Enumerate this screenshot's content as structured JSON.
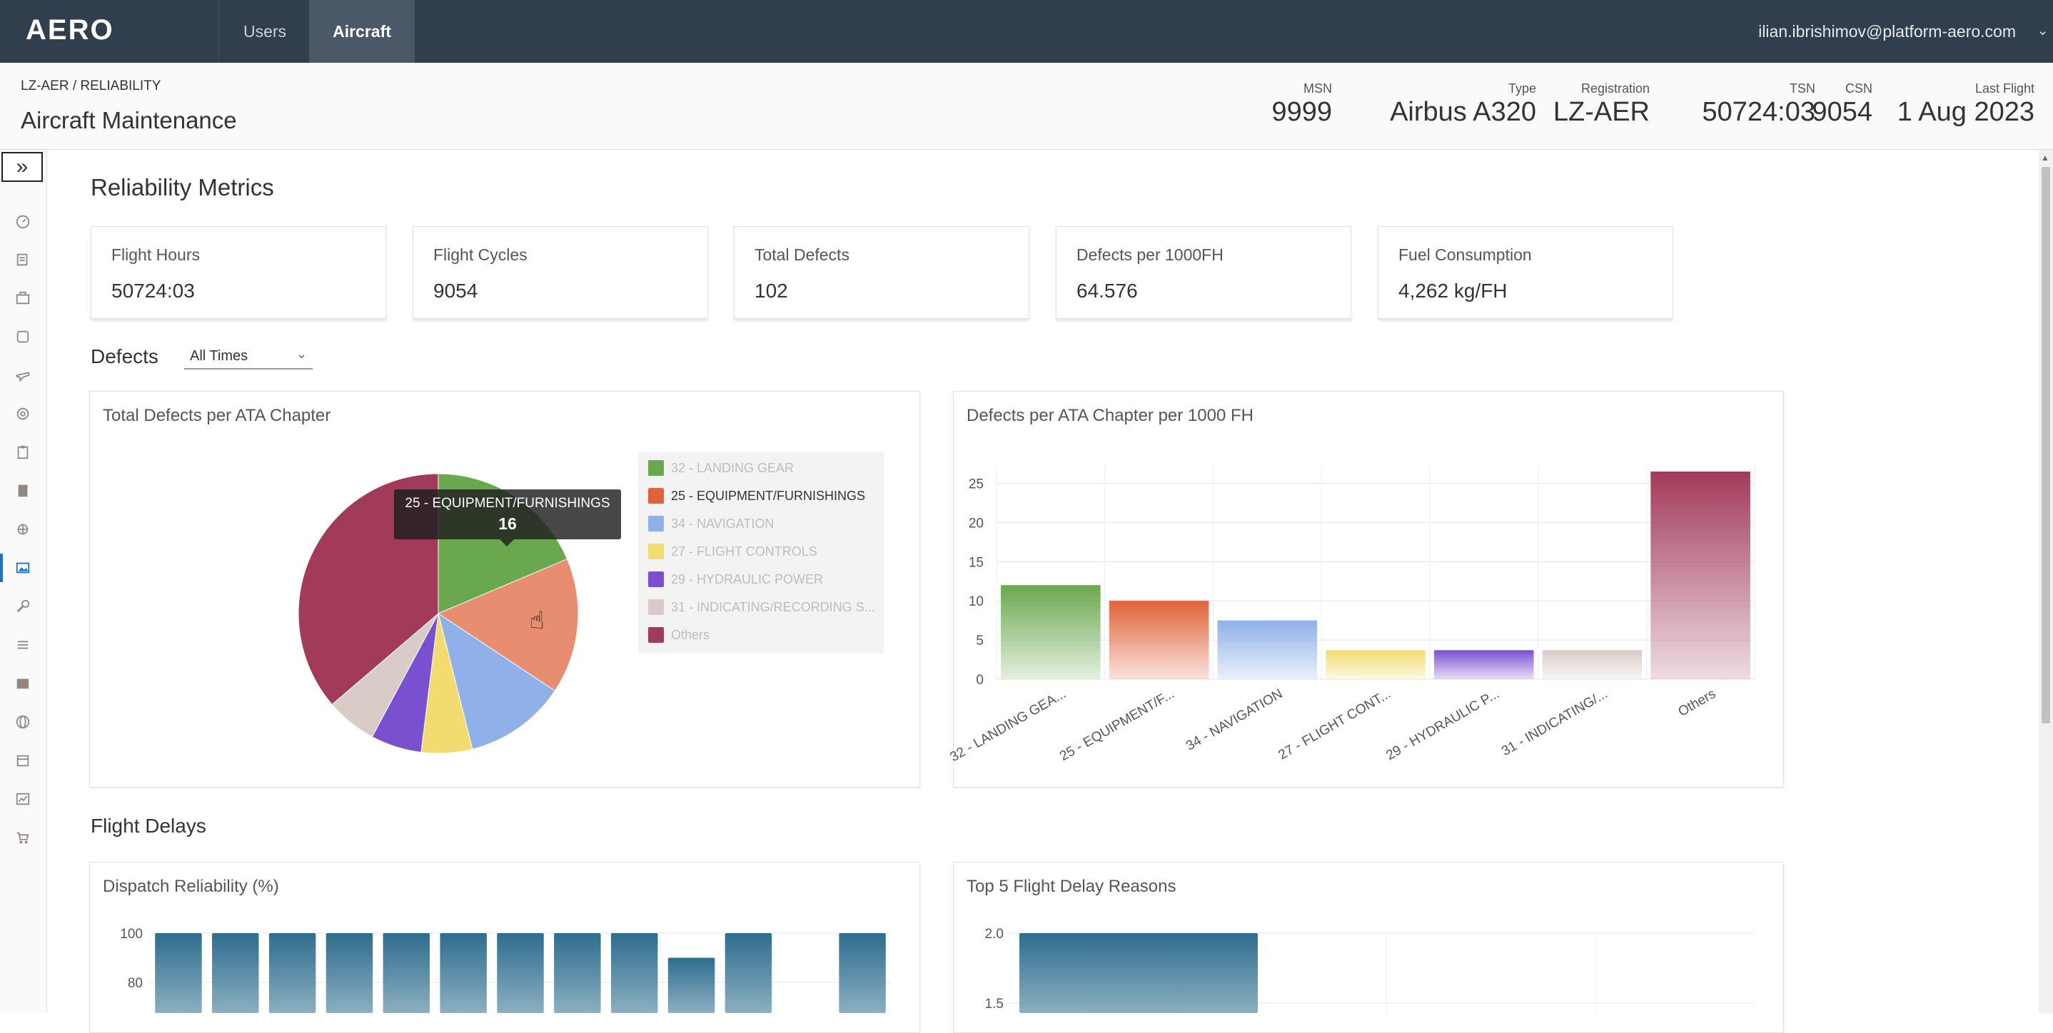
{
  "topbar": {
    "logo": "AERO",
    "nav": [
      {
        "label": "Users"
      },
      {
        "label": "Aircraft"
      }
    ],
    "user_email": "ilian.ibrishimov@platform-aero.com"
  },
  "subheader": {
    "breadcrumb": "LZ-AER / RELIABILITY",
    "title": "Aircraft Maintenance",
    "stats": [
      {
        "label": "MSN",
        "value": "9999"
      },
      {
        "label": "Type",
        "value": "Airbus A320"
      },
      {
        "label": "Registration",
        "value": "LZ-AER"
      },
      {
        "label": "TSN",
        "value": "50724:03"
      },
      {
        "label": "CSN",
        "value": "9054"
      },
      {
        "label": "Last Flight",
        "value": "1 Aug 2023"
      }
    ]
  },
  "sidebar": {
    "expand_glyph": "»",
    "icons": [
      "dashboard-icon",
      "notes-icon",
      "briefcase-icon",
      "box-icon",
      "plane-icon",
      "gear-icon",
      "clipboard-icon",
      "document-icon",
      "engine-icon",
      "image-icon",
      "wrench-icon",
      "list-icon",
      "checklist-icon",
      "globe-icon",
      "calendar-icon",
      "chart-icon",
      "cart-icon"
    ],
    "active": "image-icon"
  },
  "main": {
    "title": "Reliability Metrics",
    "kpis": [
      {
        "label": "Flight Hours",
        "value": "50724:03"
      },
      {
        "label": "Flight Cycles",
        "value": "9054"
      },
      {
        "label": "Total Defects",
        "value": "102"
      },
      {
        "label": "Defects per 1000FH",
        "value": "64.576"
      },
      {
        "label": "Fuel Consumption",
        "value": "4,262 kg/FH"
      }
    ],
    "defects_heading": "Defects",
    "period": {
      "selected": "All Times"
    },
    "flight_delays_heading": "Flight Delays"
  },
  "colors": {
    "green": "#6aa84f",
    "orange": "#e0623a",
    "blue": "#8fb0e8",
    "yellow": "#f2dc70",
    "purple": "#7a4fd0",
    "gray": "#d9cbc6",
    "maroon": "#a23a5a",
    "teal": "#2e6d8e"
  },
  "tooltip": {
    "label": "25 - EQUIPMENT/FURNISHINGS",
    "value": "16"
  },
  "chart_data": [
    {
      "type": "pie",
      "title": "Total Defects per ATA Chapter",
      "slices": [
        {
          "label": "32 - LANDING GEAR",
          "value": 19,
          "color": "#6aa84f"
        },
        {
          "label": "25 - EQUIPMENT/FURNISHINGS",
          "value": 16,
          "color": "#e0623a"
        },
        {
          "label": "34 - NAVIGATION",
          "value": 12,
          "color": "#8fb0e8"
        },
        {
          "label": "27 - FLIGHT CONTROLS",
          "value": 6,
          "color": "#f2dc70"
        },
        {
          "label": "29 - HYDRAULIC POWER",
          "value": 6,
          "color": "#7a4fd0"
        },
        {
          "label": "31 - INDICATING/RECORDING S...",
          "value": 6,
          "color": "#d9cbc6"
        },
        {
          "label": "Others",
          "value": 37,
          "color": "#a23a5a"
        }
      ]
    },
    {
      "type": "bar",
      "title": "Defects per ATA Chapter per 1000 FH",
      "categories": [
        "32 - LANDING GEA...",
        "25 - EQUIPMENT/F...",
        "34 - NAVIGATION",
        "27 - FLIGHT CONT...",
        "29 - HYDRAULIC P...",
        "31 - INDICATING/...",
        "Others"
      ],
      "values": [
        12,
        10,
        7.5,
        3.7,
        3.7,
        3.7,
        26.5
      ],
      "colors": [
        "#6aa84f",
        "#e0623a",
        "#8fb0e8",
        "#f2dc70",
        "#7a4fd0",
        "#d9cbc6",
        "#a23a5a"
      ],
      "yticks": [
        "25",
        "20",
        "15",
        "10",
        "5",
        "0"
      ],
      "ylim": [
        0,
        27.5
      ]
    },
    {
      "type": "bar",
      "title": "Dispatch Reliability (%)",
      "values": [
        100,
        100,
        100,
        100,
        100,
        100,
        100,
        100,
        100,
        90,
        100,
        null,
        100
      ],
      "yticks": [
        "100",
        "80"
      ],
      "ylim": [
        60,
        100
      ]
    },
    {
      "type": "bar",
      "title": "Top 5 Flight Delay Reasons",
      "values": [
        2.0
      ],
      "yticks": [
        "2.0",
        "1.5"
      ],
      "ylim": [
        1.0,
        2.0
      ]
    }
  ]
}
